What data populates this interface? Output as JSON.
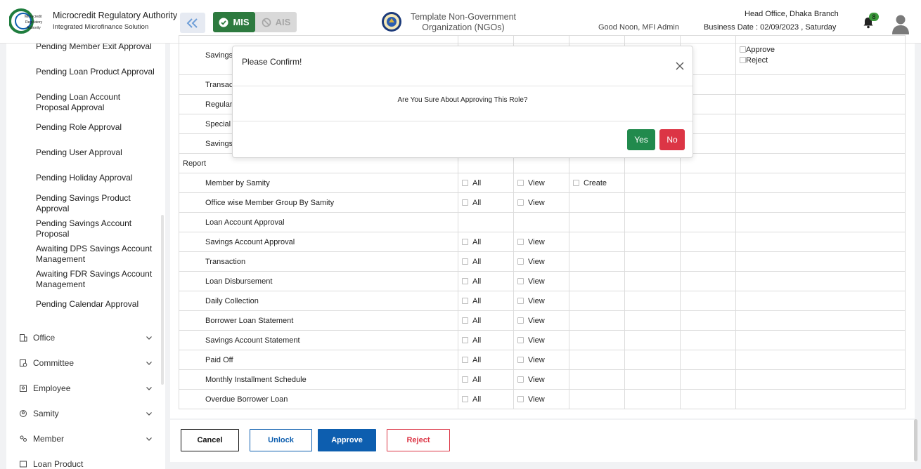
{
  "header": {
    "brand_title": "Microcredit Regulatory Authority",
    "brand_subtitle": "Integrated Microfinance Solution",
    "logo_text": "Microcredit Regulatory Authority",
    "mis_label": "MIS",
    "ais_label": "AIS",
    "org_name": "Template Non-Government Organization (NGOs)",
    "greeting": "Good Noon, MFI Admin",
    "branch": "Head Office, Dhaka Branch",
    "business_date": "Business Date : 02/09/2023 , Saturday",
    "notification_count": "8"
  },
  "sidebar": {
    "approval_items": [
      "Pending Member Exit Approval",
      "Pending Loan Product Approval",
      "Pending Loan Account Proposal Approval",
      "Pending Role Approval",
      "Pending User Approval",
      "Pending Holiday Approval",
      "Pending Savings Product Approval",
      "Pending Savings Account Proposal",
      "Awaiting DPS Savings Account Management",
      "Awaiting FDR Savings Account Management",
      "Pending Calendar Approval"
    ],
    "menus": [
      {
        "label": "Office",
        "icon": "building-icon"
      },
      {
        "label": "Committee",
        "icon": "committee-icon"
      },
      {
        "label": "Employee",
        "icon": "employee-icon"
      },
      {
        "label": "Samity",
        "icon": "samity-icon"
      },
      {
        "label": "Member",
        "icon": "member-icon"
      },
      {
        "label": "Loan Product",
        "icon": "loan-product-icon"
      }
    ]
  },
  "table": {
    "top_rows": [
      {
        "label": "Savings",
        "approve": "Approve",
        "reject": "Reject"
      },
      {
        "label": "Transact"
      },
      {
        "label": "Regular"
      },
      {
        "label": "Special I"
      },
      {
        "label": "Savings"
      }
    ],
    "section_label": "Report",
    "all_label": "All",
    "view_label": "View",
    "create_label": "Create",
    "report_rows": [
      {
        "label": "Member by Samity",
        "all": true,
        "view": true,
        "create": true
      },
      {
        "label": "Office wise Member Group By Samity",
        "all": true,
        "view": true,
        "create": false
      },
      {
        "label": "Loan Account Approval",
        "all": false,
        "view": false,
        "create": false
      },
      {
        "label": "Savings Account Approval",
        "all": true,
        "view": true,
        "create": false
      },
      {
        "label": "Transaction",
        "all": true,
        "view": true,
        "create": false
      },
      {
        "label": "Loan Disbursement",
        "all": true,
        "view": true,
        "create": false
      },
      {
        "label": "Daily Collection",
        "all": true,
        "view": true,
        "create": false
      },
      {
        "label": "Borrower Loan Statement",
        "all": true,
        "view": true,
        "create": false
      },
      {
        "label": "Savings Account Statement",
        "all": true,
        "view": true,
        "create": false
      },
      {
        "label": "Paid Off",
        "all": true,
        "view": true,
        "create": false
      },
      {
        "label": "Monthly Installment Schedule",
        "all": true,
        "view": true,
        "create": false
      },
      {
        "label": "Overdue Borrower Loan",
        "all": true,
        "view": true,
        "create": false
      }
    ]
  },
  "footer": {
    "cancel": "Cancel",
    "unlock": "Unlock",
    "approve": "Approve",
    "reject": "Reject"
  },
  "modal": {
    "title": "Please Confirm!",
    "message": "Are You Sure About Approving This Role?",
    "yes": "Yes",
    "no": "No"
  },
  "colors": {
    "primary": "#0d5eaf",
    "mis_green": "#2d7a3f",
    "danger": "#dc3545",
    "success": "#218a4d"
  }
}
